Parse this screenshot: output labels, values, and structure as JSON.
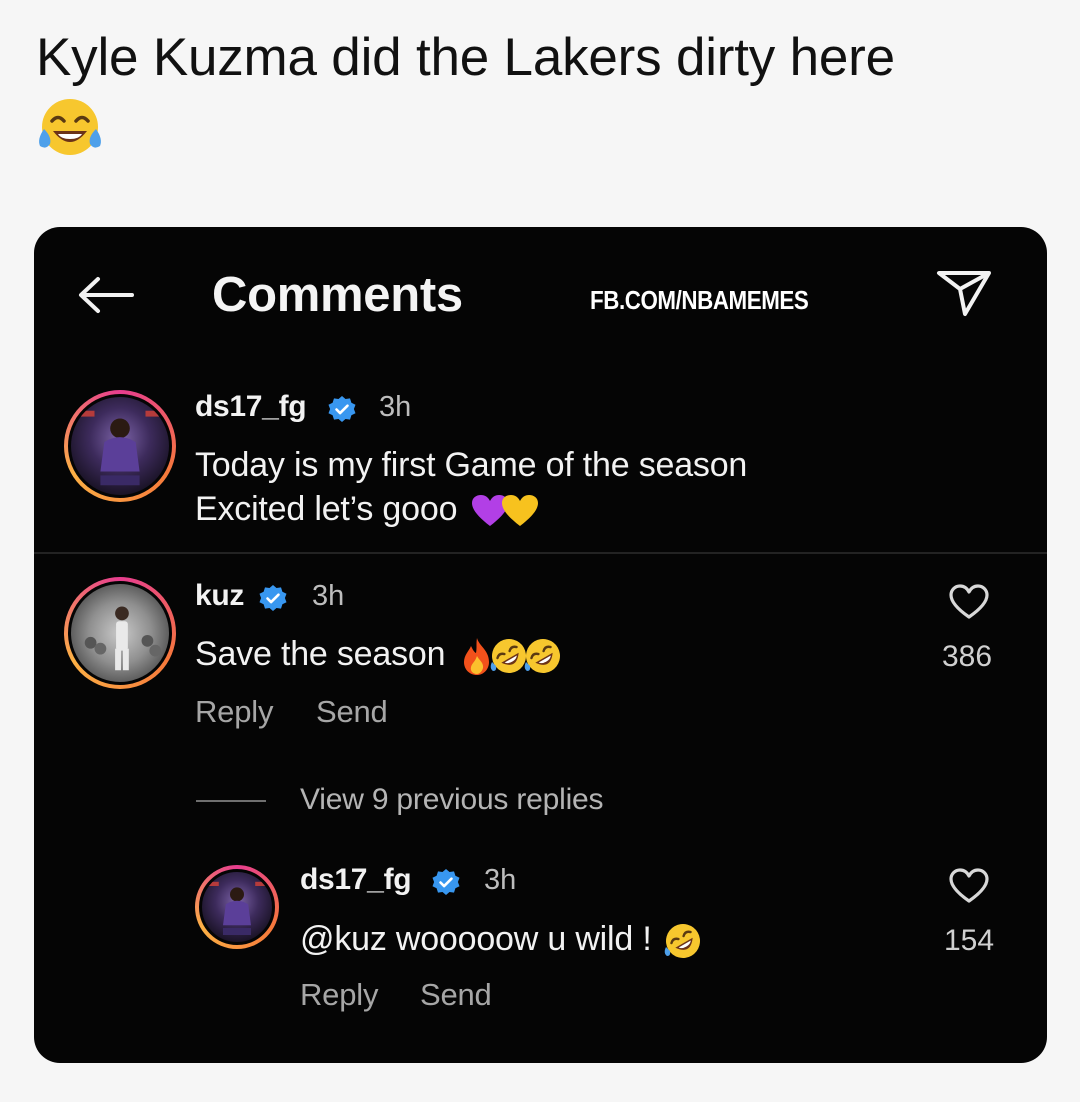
{
  "tweet": {
    "text": "Kyle Kuzma did the Lakers dirty here",
    "emoji": "face-with-tears-of-joy"
  },
  "header": {
    "title": "Comments",
    "watermark": "FB.COM/NBAMEMES",
    "back_icon": "arrow-left-icon",
    "share_icon": "paper-plane-icon"
  },
  "comments": [
    {
      "username": "ds17_fg",
      "verified": true,
      "time": "3h",
      "line1": "Today is my first Game of the season",
      "line2": "Excited let’s gooo",
      "emojis": [
        "purple-heart",
        "yellow-heart"
      ]
    },
    {
      "username": "kuz",
      "verified": true,
      "time": "3h",
      "text": "Save the season",
      "emojis": [
        "fire",
        "rolling-on-floor-laughing",
        "rolling-on-floor-laughing"
      ],
      "likes": "386",
      "reply_label": "Reply",
      "send_label": "Send"
    }
  ],
  "view_replies": "View 9 previous replies",
  "reply": {
    "username": "ds17_fg",
    "verified": true,
    "time": "3h",
    "text": "@kuz wooooow u wild !",
    "emojis": [
      "rolling-on-floor-laughing"
    ],
    "likes": "154",
    "reply_label": "Reply",
    "send_label": "Send"
  },
  "colors": {
    "background": "#f6f6f6",
    "card": "#050505",
    "verified": "#3897f0",
    "story_ring": "#e73d8f"
  }
}
